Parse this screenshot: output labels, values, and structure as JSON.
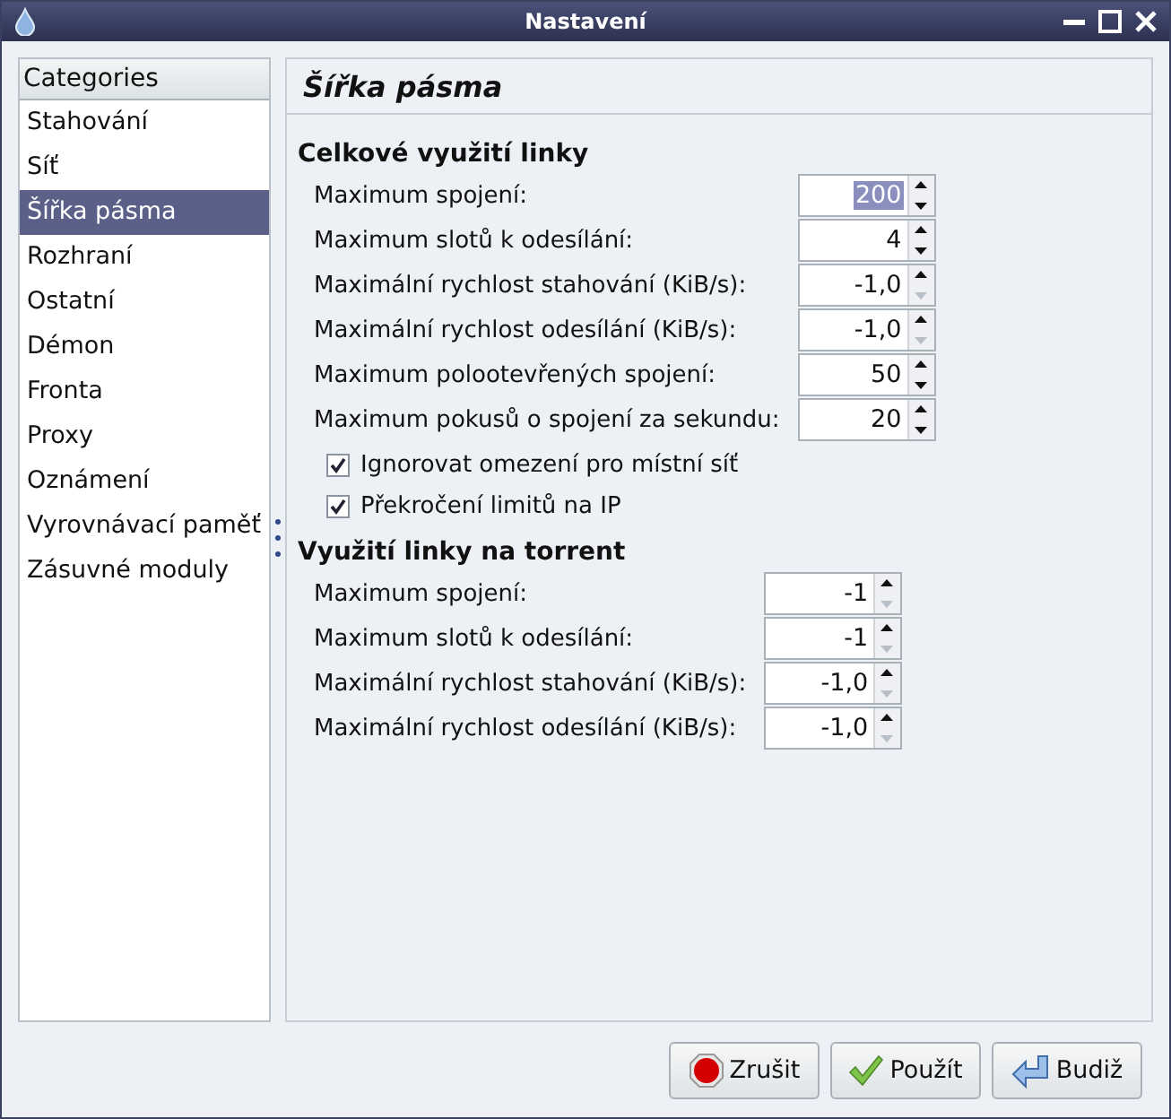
{
  "window": {
    "title": "Nastavení"
  },
  "sidebar": {
    "header": "Categories",
    "items": [
      {
        "label": "Stahování",
        "selected": false
      },
      {
        "label": "Síť",
        "selected": false
      },
      {
        "label": "Šířka pásma",
        "selected": true
      },
      {
        "label": "Rozhraní",
        "selected": false
      },
      {
        "label": "Ostatní",
        "selected": false
      },
      {
        "label": "Démon",
        "selected": false
      },
      {
        "label": "Fronta",
        "selected": false
      },
      {
        "label": "Proxy",
        "selected": false
      },
      {
        "label": "Oznámení",
        "selected": false
      },
      {
        "label": "Vyrovnávací paměť",
        "selected": false
      },
      {
        "label": "Zásuvné moduly",
        "selected": false
      }
    ]
  },
  "page": {
    "title": "Šířka pásma",
    "groups": [
      {
        "title": "Celkové využití linky",
        "fields": [
          {
            "label": "Maximum spojení:",
            "value": "200",
            "selected": true,
            "down_disabled": false
          },
          {
            "label": "Maximum slotů k odesílání:",
            "value": "4",
            "selected": false,
            "down_disabled": false
          },
          {
            "label": "Maximální rychlost stahování (KiB/s):",
            "value": "-1,0",
            "selected": false,
            "down_disabled": true
          },
          {
            "label": "Maximální rychlost odesílání (KiB/s):",
            "value": "-1,0",
            "selected": false,
            "down_disabled": true
          },
          {
            "label": "Maximum polootevřených spojení:",
            "value": "50",
            "selected": false,
            "down_disabled": false
          },
          {
            "label": "Maximum pokusů o spojení za sekundu:",
            "value": "20",
            "selected": false,
            "down_disabled": false
          }
        ],
        "checkboxes": [
          {
            "label": "Ignorovat omezení pro místní síť",
            "checked": true
          },
          {
            "label": "Překročení limitů na IP",
            "checked": true
          }
        ]
      },
      {
        "title": "Využití linky na torrent",
        "fields": [
          {
            "label": "Maximum spojení:",
            "value": "-1",
            "selected": false,
            "down_disabled": true
          },
          {
            "label": "Maximum slotů k odesílání:",
            "value": "-1",
            "selected": false,
            "down_disabled": true
          },
          {
            "label": "Maximální rychlost stahování (KiB/s):",
            "value": "-1,0",
            "selected": false,
            "down_disabled": true
          },
          {
            "label": "Maximální rychlost odesílání (KiB/s):",
            "value": "-1,0",
            "selected": false,
            "down_disabled": true
          }
        ]
      }
    ]
  },
  "buttons": [
    {
      "label": "Zrušit",
      "kind": "cancel"
    },
    {
      "label": "Použít",
      "kind": "apply"
    },
    {
      "label": "Budiž",
      "kind": "ok"
    }
  ]
}
